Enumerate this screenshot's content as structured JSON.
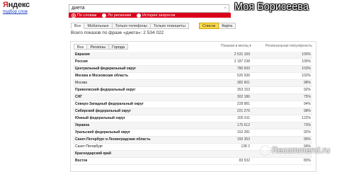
{
  "logo": {
    "main_y": "Я",
    "main_rest": "ндекс",
    "sub": "подбор слов"
  },
  "search": {
    "value": "диета",
    "clear": "×"
  },
  "radio": [
    {
      "label": "По словам",
      "checked": true
    },
    {
      "label": "По регионам",
      "checked": false
    },
    {
      "label": "История запросов",
      "checked": false
    }
  ],
  "banner": "Моя Борисеева",
  "device_tabs": [
    "Все",
    "Мобильные",
    "Только телефоны",
    "Только планшеты"
  ],
  "view_tabs": [
    "Список",
    "Карта"
  ],
  "summary": "Всего показов по фразе «диета»: 2 534 022",
  "panel_tabs": [
    "Все",
    "Регионы",
    "Города"
  ],
  "columns": {
    "count": "Показов в месяц",
    "pct": "Региональная популярность"
  },
  "rows": [
    {
      "name": "Евразия",
      "count": "2 531 169",
      "pct": "100%",
      "bold": true
    },
    {
      "name": "Россия",
      "count": "2 187 238",
      "pct": "105%",
      "bold": true
    },
    {
      "name": "Центральный федеральный округ",
      "count": "780 600",
      "pct": "103%",
      "bold": true
    },
    {
      "name": "Москва и Московская область",
      "count": "526 936",
      "pct": "102%",
      "bold": true
    },
    {
      "name": "Москва",
      "count": "382 601",
      "pct": "98%",
      "bold": false
    },
    {
      "name": "Приволжский федеральный округ",
      "count": "353 153",
      "pct": "92%",
      "bold": true
    },
    {
      "name": "СНГ",
      "count": "302 186",
      "pct": "75%",
      "bold": true
    },
    {
      "name": "Северо-Западный федеральный округ",
      "count": "228 881",
      "pct": "94%",
      "bold": true
    },
    {
      "name": "Сибирский федеральный округ",
      "count": "221 276",
      "pct": "98%",
      "bold": true
    },
    {
      "name": "Южный федеральный округ",
      "count": "205 911",
      "pct": "122%",
      "bold": true
    },
    {
      "name": "Украина",
      "count": "175 612",
      "pct": "73%",
      "bold": true
    },
    {
      "name": "Уральский федеральный округ",
      "count": "153 281",
      "pct": "92%",
      "bold": true
    },
    {
      "name": "Санкт-Петербург и Ленинградская область",
      "count": "150 353",
      "pct": "95%",
      "bold": true
    },
    {
      "name": "Санкт-Петербург",
      "count": "138 2",
      "pct": "94%",
      "bold": false
    },
    {
      "name": "Краснодарский край",
      "count": "",
      "pct": "",
      "bold": true
    },
    {
      "name": "Восток",
      "count": "83 532",
      "pct": "83%",
      "bold": true
    }
  ],
  "watermark": {
    "letter": "i",
    "text": "Recommend.ru"
  }
}
